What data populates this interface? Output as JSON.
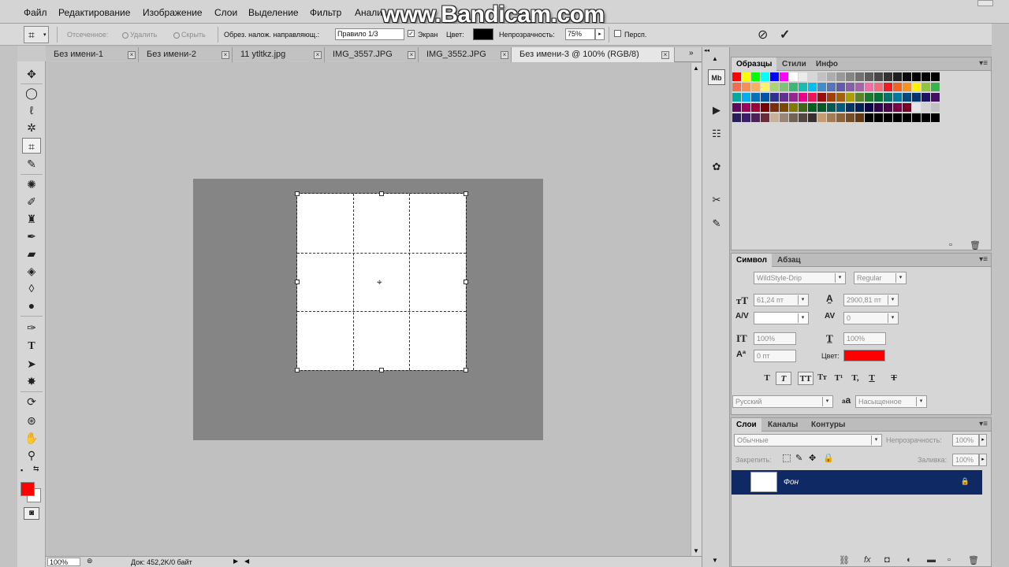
{
  "watermark": "www.Bandicam.com",
  "menu": [
    "Файл",
    "Редактирование",
    "Изображение",
    "Слои",
    "Выделение",
    "Фильтр",
    "Анализ"
  ],
  "options": {
    "cropped_label": "Отсеченное:",
    "delete_label": "Удалить",
    "hide_label": "Скрыть",
    "overlay_label": "Обрез. налож. направляющ.:",
    "overlay_value": "Правило 1/3",
    "screen_label": "Экран",
    "color_label": "Цвет:",
    "color_value": "#000000",
    "opacity_label": "Непрозрачность:",
    "opacity_value": "75%",
    "perspective_label": "Персп."
  },
  "tabs": [
    {
      "label": "Без имени-1",
      "active": false
    },
    {
      "label": "Без имени-2",
      "active": false
    },
    {
      "label": "11 ytltkz.jpg",
      "active": false
    },
    {
      "label": "IMG_3557.JPG",
      "active": false
    },
    {
      "label": "IMG_3552.JPG",
      "active": false
    },
    {
      "label": "Без имени-3 @ 100% (RGB/8)",
      "active": true
    }
  ],
  "status": {
    "zoom": "100%",
    "doc_info": "Док: 452,2K/0 байт"
  },
  "tools": {
    "foreground": "#ff0000",
    "background": "#ffffff"
  },
  "swatches_panel": {
    "tabs": [
      "Образцы",
      "Стили",
      "Инфо"
    ],
    "rows": [
      [
        "#ff0000",
        "#ffff00",
        "#00ff00",
        "#00ffff",
        "#0000ff",
        "#ff00ff",
        "#ffffff",
        "#ebebeb",
        "#d6d6d6",
        "#c2c2c2",
        "#adadad",
        "#999999",
        "#858585",
        "#707070",
        "#5c5c5c",
        "#474747",
        "#333333",
        "#1f1f1f",
        "#0a0a0a",
        "#000000",
        "#000000",
        "#000000"
      ],
      [
        "#f26c4f",
        "#f68e55",
        "#fbaf5c",
        "#fff467",
        "#acd372",
        "#7cc576",
        "#3bb878",
        "#1abbb4",
        "#00bff3",
        "#438ccb",
        "#5574b9",
        "#605ca8",
        "#855fa8",
        "#a763a9",
        "#ef6ea8",
        "#f16d7e",
        "#ee1d24",
        "#f16522",
        "#f7941d",
        "#fff100",
        "#8fc63d",
        "#37b44a"
      ],
      [
        "#00a99d",
        "#00aeef",
        "#0072bc",
        "#0054a5",
        "#2e3192",
        "#652c91",
        "#92278f",
        "#ec008b",
        "#ed145a",
        "#9e0b0f",
        "#a0410d",
        "#a36209",
        "#aba000",
        "#598527",
        "#197b30",
        "#007236",
        "#00746b",
        "#0076a3",
        "#004a80",
        "#003370",
        "#1d1363",
        "#440e62"
      ],
      [
        "#630460",
        "#9e005d",
        "#9e0039",
        "#790000",
        "#7b2e00",
        "#7d4900",
        "#827a00",
        "#406618",
        "#005e20",
        "#005826",
        "#005952",
        "#005b7f",
        "#003663",
        "#002157",
        "#0d004c",
        "#32004b",
        "#4b0049",
        "#7b0046",
        "#7a0026",
        "#e6e6e6",
        "#d3d3d3",
        "#c2c2c2"
      ],
      [
        "#2a1d5c",
        "#3a1d6b",
        "#4f1f5a",
        "#6b2c3a",
        "#c7b299",
        "#998675",
        "#736357",
        "#534741",
        "#37302d",
        "#c69c6e",
        "#a67c52",
        "#8c6239",
        "#754c24",
        "#603913",
        "#000000",
        "#000000",
        "#000000",
        "#000000",
        "#000000",
        "#000000",
        "#000000",
        "#000000"
      ]
    ]
  },
  "character_panel": {
    "tabs": [
      "Символ",
      "Абзац"
    ],
    "font_family": "WildStyle-Drip",
    "font_style": "Regular",
    "font_size": "61,24 пт",
    "leading": "2900,81 пт",
    "kerning": "",
    "tracking": "0",
    "vscale": "100%",
    "hscale": "100%",
    "baseline": "0 пт",
    "color_label": "Цвет:",
    "color": "#ff0000",
    "format_buttons": [
      "T",
      "T",
      "TT",
      "Tт",
      "T¹",
      "T,",
      "T"
    ],
    "language": "Русский",
    "aa_label": "a",
    "antialias": "Насыщенное"
  },
  "layers_panel": {
    "tabs": [
      "Слои",
      "Каналы",
      "Контуры"
    ],
    "blend_mode": "Обычные",
    "opacity_label": "Непрозрачность:",
    "opacity": "100%",
    "lock_label": "Закрепить:",
    "fill_label": "Заливка:",
    "fill": "100%",
    "layers": [
      {
        "name": "Фон",
        "selected": true
      }
    ]
  }
}
